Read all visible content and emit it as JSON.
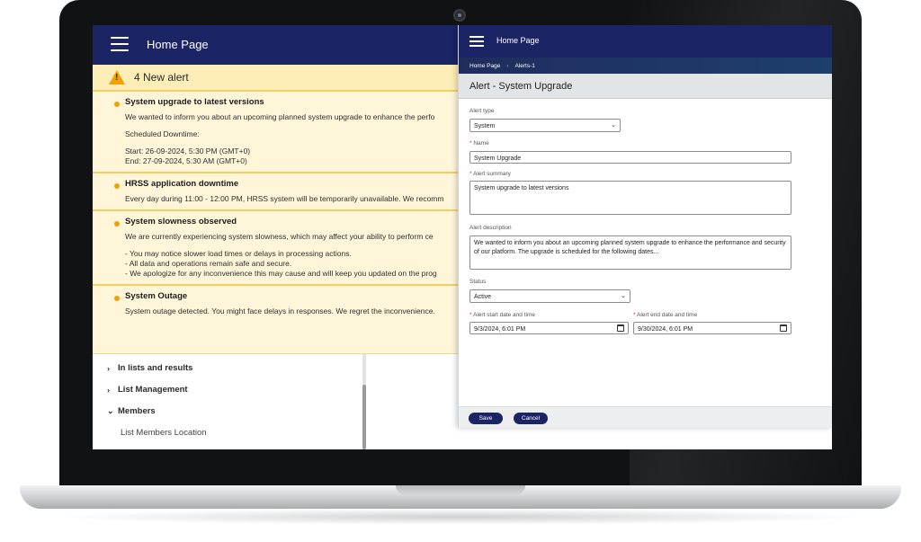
{
  "left": {
    "header_title": "Home Page",
    "banner": "4 New alert",
    "alerts": [
      {
        "title": "System upgrade to latest versions",
        "lines": [
          "We wanted to inform you about an upcoming planned system upgrade to enhance the perfo",
          "",
          "Scheduled Downtime:",
          "",
          "Start: 26-09-2024, 5:30 PM (GMT+0)",
          "End: 27-09-2024, 5:30 AM (GMT+0)"
        ]
      },
      {
        "title": "HRSS application downtime",
        "lines": [
          "Every day during 11:00 - 12:00 PM, HRSS system will be temporarily unavailable. We recomm"
        ]
      },
      {
        "title": "System slowness observed",
        "lines": [
          "We are currently experiencing system slowness, which may affect your ability to perform ce",
          "",
          "- You may notice slower load times or delays in processing actions.",
          "- All data and operations remain safe and secure.",
          "- We apologize for any inconvenience this may cause and will keep you updated on the prog"
        ]
      },
      {
        "title": "System Outage",
        "lines": [
          "System outage detected. You might face delays in responses. We regret the inconvenience."
        ]
      }
    ],
    "tree": {
      "item1": "In lists and results",
      "item2": "List Management",
      "item3": "Members",
      "sub1": "List Members Location"
    }
  },
  "panel": {
    "header_title": "Home Page",
    "breadcrumb": {
      "home": "Home Page",
      "sep": "›",
      "current": "Alerts-1"
    },
    "form_title": "Alert - System Upgrade",
    "alert_type": {
      "label": "Alert type",
      "value": "System"
    },
    "name": {
      "required": "*",
      "label": "Name",
      "value": "System Upgrade"
    },
    "summary": {
      "required": "*",
      "label": "Alert summary",
      "value": "System upgrade to latest versions"
    },
    "description": {
      "label": "Alert description",
      "value": "We wanted to inform you about an upcoming planned system upgrade to enhance the performance and security of our platform. The upgrade is scheduled for the following dates..."
    },
    "status": {
      "label": "Status",
      "value": "Active"
    },
    "start": {
      "required": "*",
      "label": "Alert start date and time",
      "value": "9/3/2024, 6:01 PM"
    },
    "end": {
      "required": "*",
      "label": "Alert end date and time",
      "value": "9/30/2024, 6:01 PM"
    },
    "save_label": "Save",
    "cancel_label": "Cancel"
  },
  "icons": {
    "menu": "hamburger-menu-icon",
    "warning": "warning-triangle-icon",
    "chevron_right": "chevron-right-icon",
    "chevron_down": "chevron-down-icon",
    "calendar": "calendar-icon"
  },
  "colors": {
    "header_navy": "#1b2566",
    "alert_bg": "#fff6d9",
    "alert_accent": "#f0a202",
    "button": "#1b2566"
  }
}
